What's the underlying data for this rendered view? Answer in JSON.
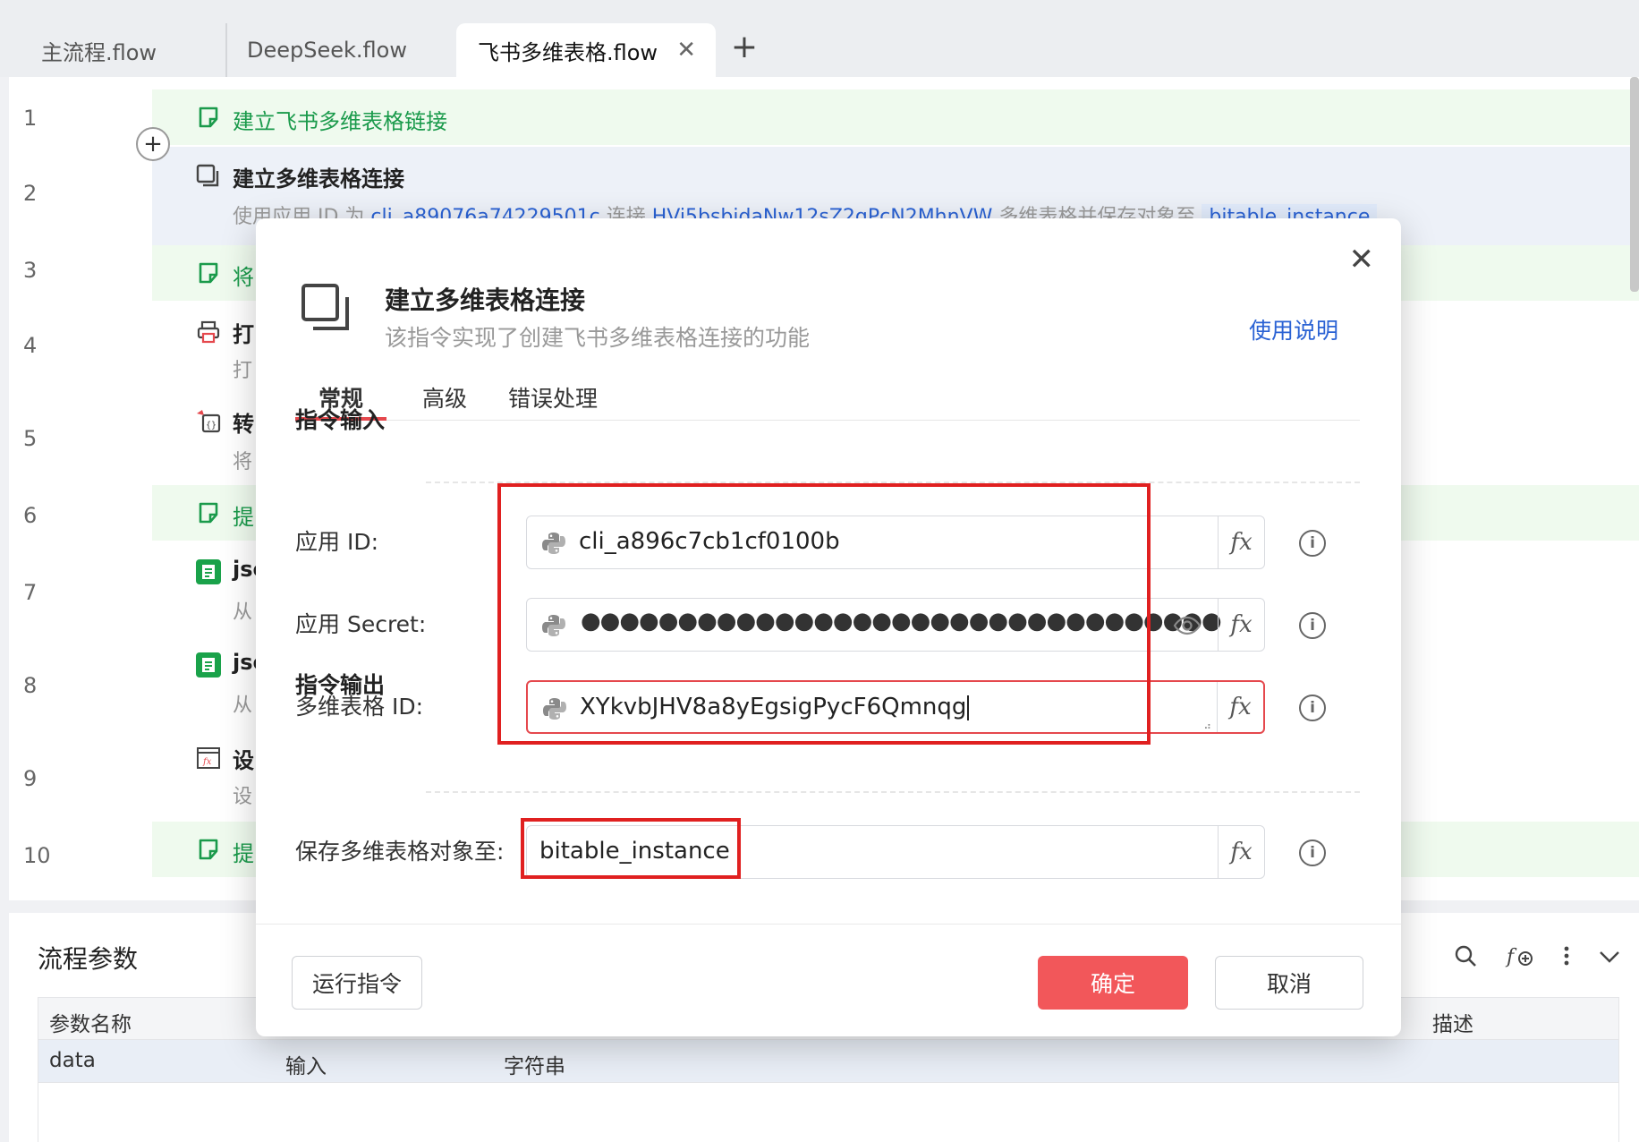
{
  "tabs": [
    {
      "label": "主流程.flow"
    },
    {
      "label": "DeepSeek.flow"
    },
    {
      "label": "飞书多维表格.flow",
      "close": "✕"
    }
  ],
  "add_tab": "+",
  "editor": {
    "line_numbers": [
      "1",
      "2",
      "3",
      "4",
      "5",
      "6",
      "7",
      "8",
      "9",
      "10"
    ],
    "rows": {
      "r1": {
        "title": "建立飞书多维表格链接"
      },
      "r2": {
        "title": "建立多维表格连接",
        "sub_pre": "使用应用 ID 为 ",
        "app_id": "cli_a89076a74229501c",
        "sub_mid": " 连接 ",
        "table_id": "HVi5bsbjdaNw12sZ2gPcN2MhnVW",
        "sub_post": " 多维表格并保存对象至 ",
        "var": "bitable_instance"
      },
      "r3": {
        "title": "将"
      },
      "r4": {
        "title": "打",
        "sub": "打"
      },
      "r5": {
        "title": "转",
        "sub": "将"
      },
      "r6": {
        "title": "提"
      },
      "r7": {
        "title": "jso",
        "sub": "从"
      },
      "r8": {
        "title": "jso",
        "sub": "从"
      },
      "r9": {
        "title": "设",
        "sub": "设"
      },
      "r10": {
        "title": "提"
      }
    }
  },
  "params": {
    "title": "流程参数",
    "columns": [
      "参数名称",
      "描述"
    ],
    "rows": [
      {
        "name": "data",
        "direction": "输入",
        "type": "字符串"
      }
    ]
  },
  "modal": {
    "title": "建立多维表格连接",
    "subtitle": "该指令实现了创建飞书多维表格连接的功能",
    "help": "使用说明",
    "tabs": [
      "常规",
      "高级",
      "错误处理"
    ],
    "input_section": "指令输入",
    "output_section": "指令输出",
    "fields": {
      "app_id": {
        "label": "应用 ID:",
        "value": "cli_a896c7cb1cf0100b"
      },
      "app_secret": {
        "label": "应用 Secret:",
        "value": "●●●●●●●●●●●●●●●●●●●●●●●●●●●●●●●●●"
      },
      "table_id": {
        "label": "多维表格 ID:",
        "value": "XYkvbJHV8a8yEgsigPycF6Qmnqg"
      },
      "save_to": {
        "label": "保存多维表格对象至:",
        "value": "bitable_instance"
      }
    },
    "fx_label": "fx",
    "buttons": {
      "run": "运行指令",
      "ok": "确定",
      "cancel": "取消"
    }
  },
  "colors": {
    "accent": "#f2575a",
    "link": "#2a62d4",
    "highlight_box": "#e02020",
    "comment_green": "#1a9a4b"
  }
}
